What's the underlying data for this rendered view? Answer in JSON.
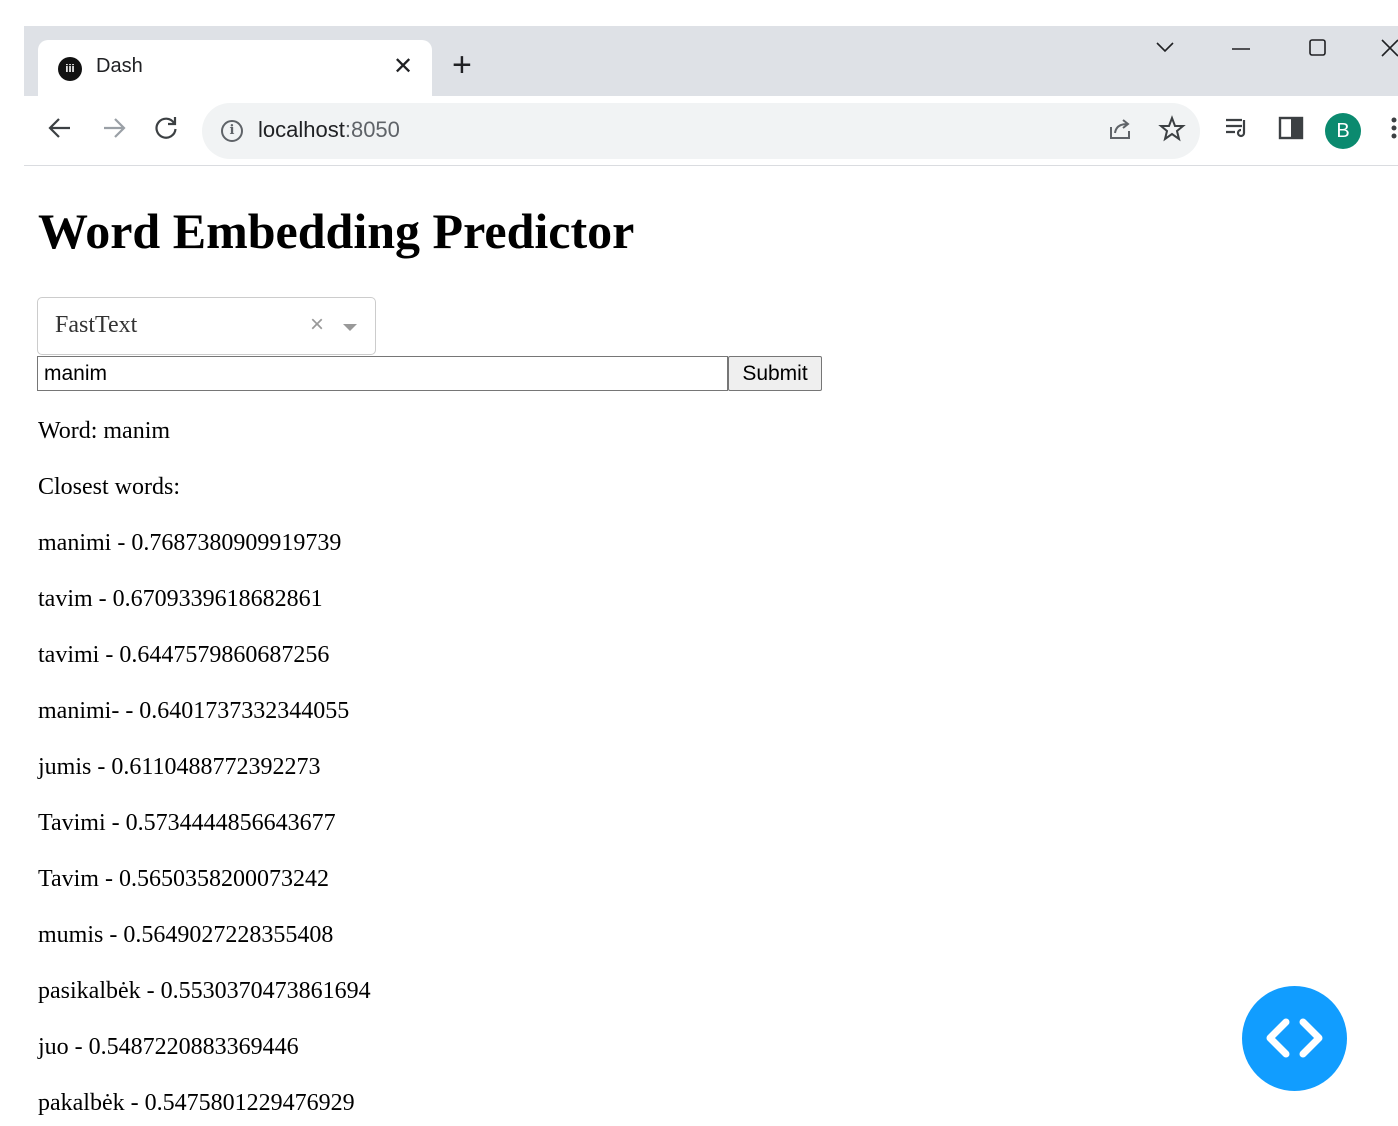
{
  "browser": {
    "tab_title": "Dash",
    "tab_favicon_glyph": "iii",
    "url_host": "localhost",
    "url_port": ":8050",
    "avatar_letter": "B"
  },
  "page": {
    "title": "Word Embedding Predictor",
    "model_dropdown": {
      "selected": "FastText"
    },
    "word_input": {
      "value": "manim"
    },
    "submit_label": "Submit",
    "word_line": "Word: manim",
    "closest_label": "Closest words:",
    "closest_words": [
      "manimi - 0.7687380909919739",
      "tavim - 0.6709339618682861",
      "tavimi - 0.6447579860687256",
      "manimi- - 0.6401737332344055",
      "jumis - 0.6110488772392273",
      "Tavimi - 0.5734444856643677",
      "Tavim - 0.5650358200073242",
      "mumis - 0.5649027228355408",
      "pasikalbėk - 0.5530370473861694",
      "juo - 0.5487220883369446",
      "pakalbėk - 0.5475801229476929"
    ]
  },
  "colors": {
    "fab": "#119dff",
    "avatar": "#0b8a6f",
    "tabstrip": "#dee1e6"
  }
}
